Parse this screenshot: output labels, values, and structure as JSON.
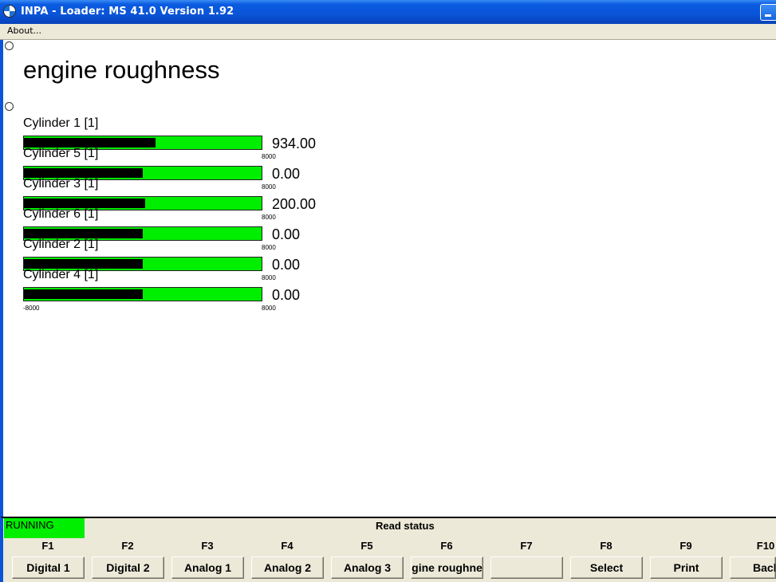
{
  "window": {
    "title": "INPA - Loader:  MS 41.0 Version 1.92"
  },
  "menu": {
    "about": "About..."
  },
  "screen": {
    "heading": "engine roughness",
    "gauges": [
      {
        "label": "Cylinder 1 [1]",
        "value": "934.00",
        "fill_fraction": 0.555,
        "scale_min": "",
        "scale_max": "8000"
      },
      {
        "label": "Cylinder 5 [1]",
        "value": "0.00",
        "fill_fraction": 0.5,
        "scale_min": "",
        "scale_max": "8000"
      },
      {
        "label": "Cylinder 3 [1]",
        "value": "200.00",
        "fill_fraction": 0.51,
        "scale_min": "",
        "scale_max": "8000"
      },
      {
        "label": "Cylinder 6 [1]",
        "value": "0.00",
        "fill_fraction": 0.5,
        "scale_min": "",
        "scale_max": "8000"
      },
      {
        "label": "Cylinder 2 [1]",
        "value": "0.00",
        "fill_fraction": 0.5,
        "scale_min": "",
        "scale_max": "8000"
      },
      {
        "label": "Cylinder 4 [1]",
        "value": "0.00",
        "fill_fraction": 0.5,
        "scale_min": "-8000",
        "scale_max": "8000"
      }
    ]
  },
  "status": {
    "running": "RUNNING",
    "text": "Read status"
  },
  "function_keys": [
    {
      "key": "F1",
      "label": "Digital 1"
    },
    {
      "key": "F2",
      "label": "Digital 2"
    },
    {
      "key": "F3",
      "label": "Analog 1"
    },
    {
      "key": "F4",
      "label": "Analog 2"
    },
    {
      "key": "F5",
      "label": "Analog 3"
    },
    {
      "key": "F6",
      "label": "gine roughne"
    },
    {
      "key": "F7",
      "label": ""
    },
    {
      "key": "F8",
      "label": "Select"
    },
    {
      "key": "F9",
      "label": "Print"
    },
    {
      "key": "F10",
      "label": "Back"
    }
  ],
  "colors": {
    "bar_green": "#00ee00",
    "bar_black": "#000000",
    "titlebar_blue": "#0a54d8"
  }
}
